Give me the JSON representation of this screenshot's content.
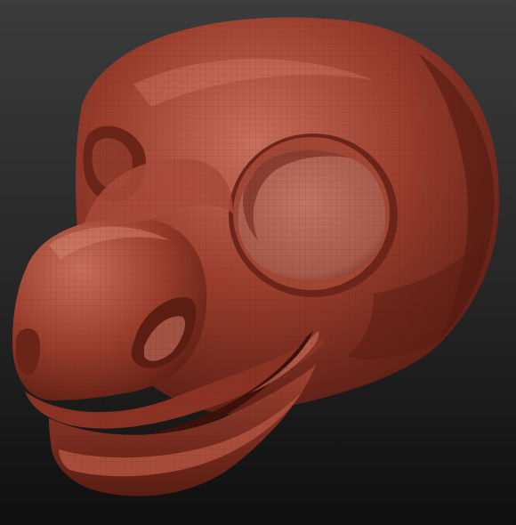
{
  "viewport": {
    "subject": "sculpted-head-model",
    "background_colors": [
      "#3b3b3b",
      "#262626",
      "#0f0f0f"
    ],
    "material_colors": {
      "base": "#9c3e2d",
      "highlight": "#c7705b",
      "shadow": "#4e1710",
      "eye_inner": "#b66a5c",
      "wire": "#5a1a12"
    },
    "wireframe": true
  }
}
